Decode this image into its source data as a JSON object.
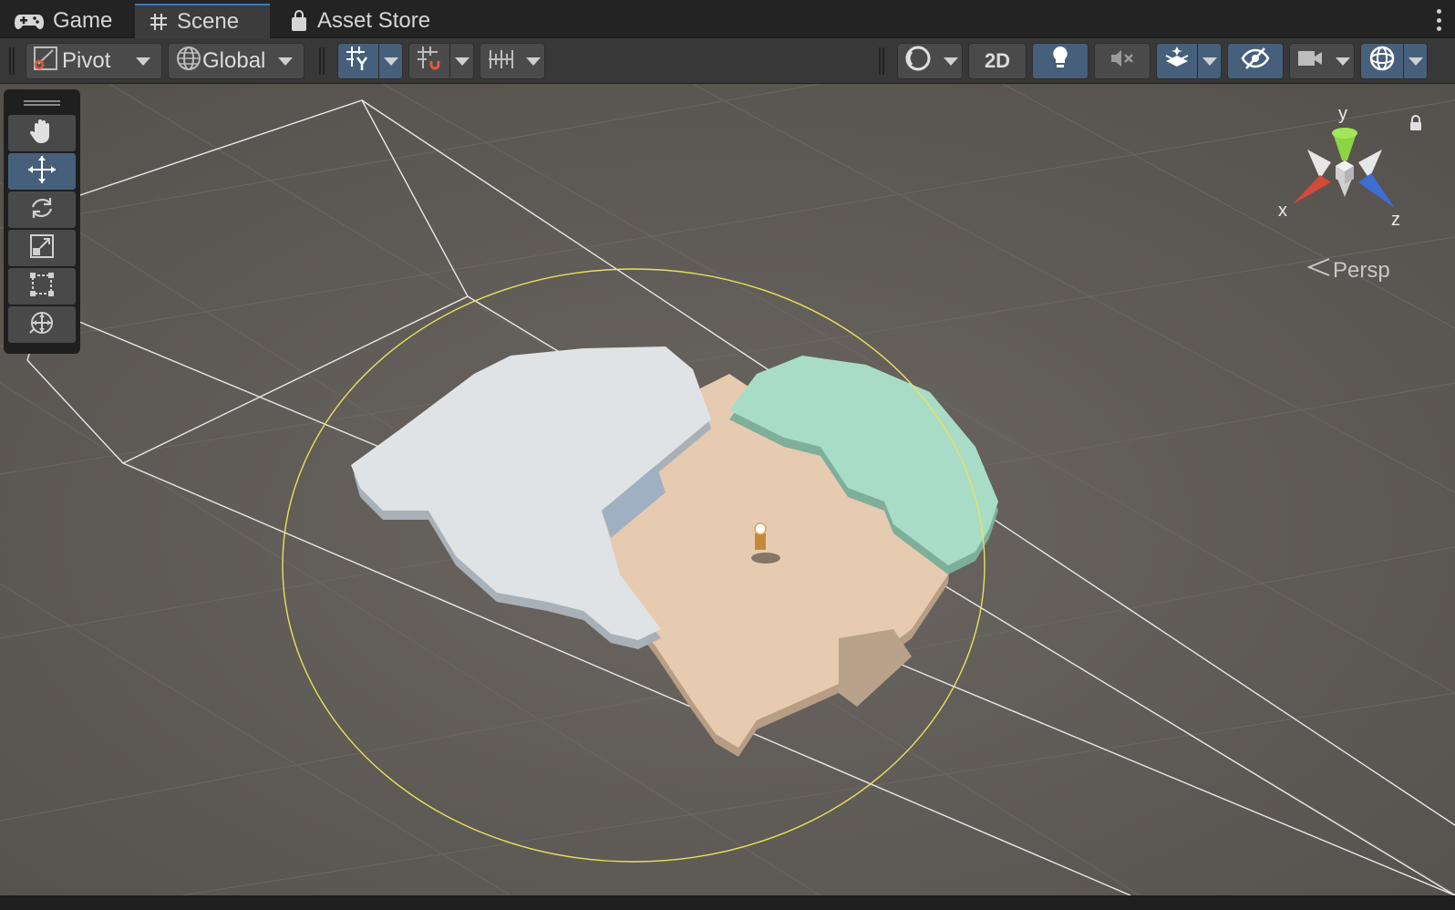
{
  "tabs": [
    {
      "label": "Game",
      "icon": "gamepad-icon"
    },
    {
      "label": "Scene",
      "icon": "grid-hash-icon",
      "active": true
    },
    {
      "label": "Asset Store",
      "icon": "shopping-bag-icon"
    }
  ],
  "toolbar": {
    "pivot_label": "Pivot",
    "global_label": "Global",
    "mode_2d_label": "2D"
  },
  "tools": [
    {
      "name": "hand-tool",
      "icon": "hand-icon"
    },
    {
      "name": "move-tool",
      "icon": "move-arrows-icon",
      "active": true
    },
    {
      "name": "rotate-tool",
      "icon": "rotate-icon"
    },
    {
      "name": "scale-tool",
      "icon": "scale-icon"
    },
    {
      "name": "rect-tool",
      "icon": "rect-transform-icon"
    },
    {
      "name": "transform-tool",
      "icon": "transform-icon"
    }
  ],
  "gizmo": {
    "y_label": "y",
    "x_label": "x",
    "z_label": "z",
    "projection_label": "Persp"
  },
  "colors": {
    "active_blue": "#46607c",
    "accent_tab": "#3a79bb",
    "ground": "#5d5954",
    "snow": "#dfe3e6",
    "sand": "#e6cbb0",
    "grass": "#a9dcc7",
    "gizmo_x": "#d34a3a",
    "gizmo_y": "#8bd442",
    "gizmo_z": "#3c6fd6",
    "light_range": "#e8e25a"
  }
}
